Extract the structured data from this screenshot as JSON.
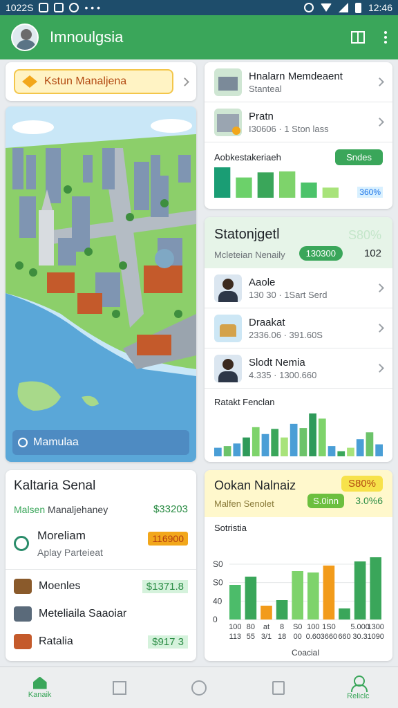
{
  "status_bar": {
    "time_left": "1022S",
    "time_right": "12:46"
  },
  "app_bar": {
    "title": "Imnoulgsia"
  },
  "pill_card": {
    "label": "Kstun Manaljena"
  },
  "map_card": {
    "label": "Mamulaa"
  },
  "list_card": {
    "rows": [
      {
        "title": "Hnalarn Memdeaent",
        "subtitle": "Stanteal"
      },
      {
        "title": "Pratn",
        "subtitle": "I30606 · 1 Ston lass"
      }
    ],
    "chart_title": "Aobkestakeriaeh",
    "button_label": "Sndes",
    "value_label": "360%",
    "chart_data": {
      "type": "bar",
      "values": [
        6,
        4,
        5,
        5.2,
        3,
        2
      ],
      "colors": [
        "#1a9d74",
        "#6cd16a",
        "#3aa65a",
        "#7ed36b",
        "#4cc36a",
        "#a8e37a"
      ]
    }
  },
  "stats_card": {
    "title": "Statonjgetl",
    "faded_value": "S80%",
    "subtitle": "Mcleteian Nenaily",
    "badge": "130300",
    "badge2": "102",
    "rows": [
      {
        "title": "Aaole",
        "subtitle": "130 30 · 1Sart Serd"
      },
      {
        "title": "Draakat",
        "subtitle": "2336.06 · 391.60S"
      },
      {
        "title": "Slodt Nemia",
        "subtitle": "4.335 · 1300.660"
      }
    ],
    "chart_title": "Ratakt Fenclan",
    "chart_data": {
      "type": "bar",
      "values": [
        1,
        1.2,
        1.5,
        2.2,
        3.4,
        2.6,
        3.2,
        2.2,
        3.8,
        3.3,
        5,
        4.4,
        1.2,
        0.6,
        1,
        2,
        2.8,
        1.4
      ],
      "colors": [
        "#4a9ed6",
        "#6cc36a",
        "#4a9ed6",
        "#2f9a5a",
        "#7ed36b",
        "#4a9ed6",
        "#3aa65a",
        "#a8e37a",
        "#4a9ed6",
        "#6cc36a",
        "#2f9a5a",
        "#7ed36b",
        "#4a9ed6",
        "#3aa65a",
        "#a8e37a",
        "#4a9ed6",
        "#6cc36a",
        "#4a9ed6"
      ]
    }
  },
  "bl_card": {
    "title": "Kaltaria Senal",
    "row_label_green": "Malsen",
    "row_label_dark": "Manaljehaney",
    "row_amount": "$33203",
    "mid_title": "Moreliam",
    "mid_sub": "Aplay Parteieat",
    "mid_badge": "116900",
    "items": [
      {
        "name": "Moenles",
        "amount": "$1371.8",
        "color": "#8a5a2b"
      },
      {
        "name": "Meteliaila Saaoiar",
        "amount": "",
        "color": "#5a6a7a"
      },
      {
        "name": "Ratalia",
        "amount": "$917 3",
        "color": "#c45a2b"
      }
    ]
  },
  "br_card": {
    "title": "Ookan Nalnaiz",
    "subtitle": "Malfen Senolet",
    "badge_yellow": "S80%",
    "badge_green": "S.0inn",
    "badge_green2": "3.0%6",
    "chart_title": "Sotristia",
    "chart_data": {
      "type": "bar",
      "categories": [
        "100\n113",
        "80\n55",
        "at\n3/1",
        "8\n18",
        "S0\n00",
        "100\n0.60",
        "1S0\n3660",
        "\n660",
        "5.000\n30.3",
        "1300\n1090"
      ],
      "values": [
        50,
        62,
        20,
        28,
        70,
        68,
        78,
        16,
        84,
        90
      ],
      "colors": [
        "#4cbc6a",
        "#3aa65a",
        "#f29b1b",
        "#3aa65a",
        "#7ed36b",
        "#7ed36b",
        "#f29b1b",
        "#3aa65a",
        "#3aa65a",
        "#3aa65a"
      ],
      "yticks": [
        "0",
        "40",
        "S0",
        "S0"
      ],
      "xlabel": "Coacial"
    }
  },
  "bottom_nav": {
    "home": "Kanaik",
    "profile": "Reliclc"
  }
}
